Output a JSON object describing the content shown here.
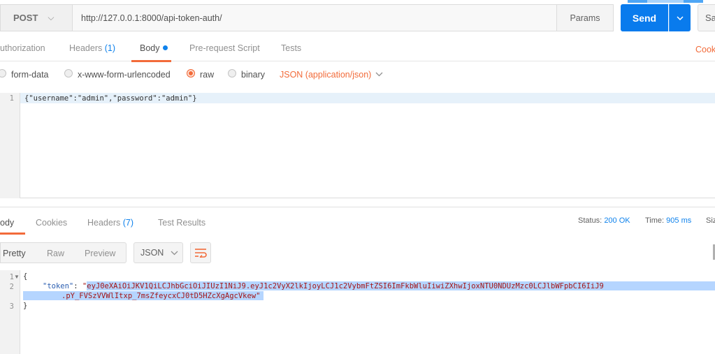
{
  "request": {
    "method": "POST",
    "url": "http://127.0.0.1:8000/api-token-auth/",
    "params_label": "Params",
    "send_label": "Send",
    "save_label": "Sa"
  },
  "tabs": {
    "authorization": "uthorization",
    "headers": "Headers",
    "headers_count": "(1)",
    "body": "Body",
    "prerequest": "Pre-request Script",
    "tests": "Tests",
    "cookies": "Cooki"
  },
  "body_types": {
    "form_data": "form-data",
    "urlencoded": "x-www-form-urlencoded",
    "raw": "raw",
    "binary": "binary",
    "content_type": "JSON (application/json)"
  },
  "request_body": {
    "line_number": "1",
    "text": "{\"username\":\"admin\",\"password\":\"admin\"}"
  },
  "response_tabs": {
    "body": "ody",
    "cookies": "Cookies",
    "headers": "Headers",
    "headers_count": "(7)",
    "test_results": "Test Results"
  },
  "response_status": {
    "status_label": "Status:",
    "status_value": "200 OK",
    "time_label": "Time:",
    "time_value": "905 ms",
    "size_label": "Siz"
  },
  "response_view": {
    "pretty": "Pretty",
    "raw": "Raw",
    "preview": "Preview",
    "format": "JSON"
  },
  "response_body": {
    "lines": [
      "1",
      "2",
      "",
      "3"
    ],
    "open_brace": "{",
    "token_key": "\"token\"",
    "colon": ": ",
    "quote_open": "\"",
    "token_part1": "eyJ0eXAiOiJKV1QiLCJhbGciOiJIUzI1NiJ9.eyJ1c2VyX2lkIjoyLCJ1c2VybmFtZSI6ImFkbWluIiwiZXhwIjoxNTU0NDUzMzc0LCJlbWFpbCI6IiJ9",
    "token_part2": ".pY_FVSzVVWlItxp_7msZfeycxCJ0tD5HZcXgAgcVkew",
    "quote_close": "\"",
    "close_brace": "}"
  },
  "colors": {
    "accent": "#f26b3a",
    "send_blue": "#097bed",
    "link_blue": "#0f82ec"
  }
}
